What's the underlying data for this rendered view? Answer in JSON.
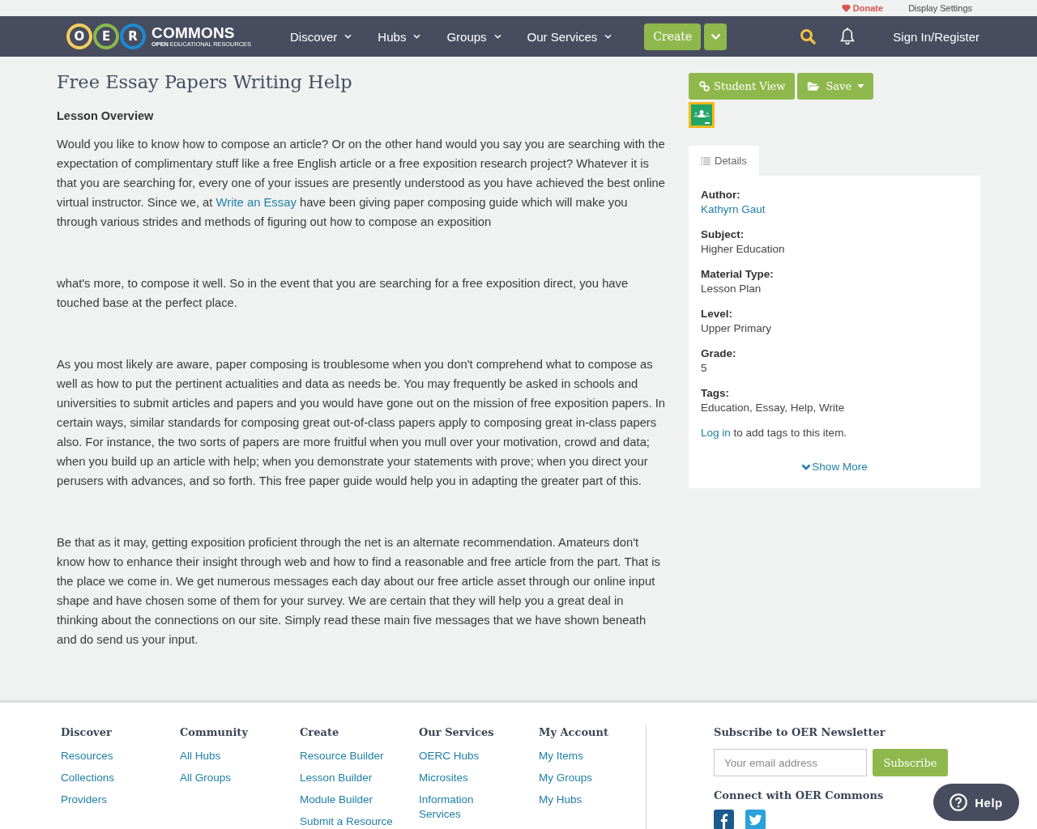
{
  "top_bar": {
    "donate": "Donate",
    "display_settings": "Display Settings"
  },
  "nav": {
    "logo": {
      "letters": [
        {
          "letter": "O",
          "color": "#f6cd5e"
        },
        {
          "letter": "E",
          "color": "#8bb94a"
        },
        {
          "letter": "R",
          "color": "#1e8ad2"
        }
      ],
      "wordmark": "COMMONS",
      "tagline": "**OPEN** EDUCATIONAL RESOURCES"
    },
    "menu": [
      {
        "label": "Discover"
      },
      {
        "label": "Hubs"
      },
      {
        "label": "Groups"
      },
      {
        "label": "Our Services"
      }
    ],
    "create": "Create",
    "sign_in": "Sign In/Register"
  },
  "article": {
    "title": "Free Essay Papers Writing Help",
    "section_heading": "Lesson Overview",
    "paragraphs": [
      {
        "parts": [
          {
            "kind": "text",
            "text": "Would you like to know how to compose an article? Or on the other hand would you say you are searching with the expectation of complimentary stuff like a free English article or a free exposition research project? Whatever it is that you are searching for, every one of your issues are presently understood as you have achieved the best online virtual instructor. Since we, at "
          },
          {
            "kind": "link",
            "text": "Write an Essay"
          },
          {
            "kind": "text",
            "text": " have been giving paper composing guide which will make you through various strides and methods of figuring out how to compose an exposition"
          }
        ]
      },
      {
        "parts": [
          {
            "kind": "text",
            "text": "what's more, to compose it well. So in the event that you are searching for a free exposition direct, you have touched base at the perfect place."
          }
        ]
      },
      {
        "parts": [
          {
            "kind": "text",
            "text": "As you most likely are aware, paper composing is troublesome when you don't comprehend what to compose as well as how to put the pertinent actualities and data as needs be. You may frequently be asked in schools and universities to submit articles and papers and you would have gone out on the mission of free exposition papers. In certain ways, similar standards for composing great out-of-class papers apply to composing great in-class papers also. For instance, the two sorts of papers are more fruitful when you mull over your motivation, crowd and data; when you build up an article with help; when you demonstrate your statements with prove; when you direct your perusers with advances, and so forth. This free paper guide would help you in adapting the greater part of this."
          }
        ]
      },
      {
        "parts": [
          {
            "kind": "text",
            "text": "Be that as it may, getting exposition proficient through the net is an alternate recommendation. Amateurs don't know how to enhance their insight through web and how to find a reasonable and free article from the part. That is the place we come in. We get numerous messages each day about our free article asset through our online input shape and have chosen some of them for your survey. We are certain that they will help you a great deal in thinking about the connections on our site. Simply read these main five messages that we have shown beneath and do send us your input."
          }
        ]
      }
    ]
  },
  "sidebar": {
    "actions": {
      "student_view": "Student View",
      "save": "Save"
    },
    "tabs": [
      {
        "label": "Details",
        "selected": true
      }
    ],
    "fields": [
      {
        "label": "Author:",
        "value": "Kathyrn Gaut",
        "kind": "link"
      },
      {
        "label": "Subject:",
        "value": "Higher Education",
        "kind": "text"
      },
      {
        "label": "Material Type:",
        "value": "Lesson Plan",
        "kind": "text"
      },
      {
        "label": "Level:",
        "value": "Upper Primary",
        "kind": "text"
      },
      {
        "label": "Grade:",
        "value": "5",
        "kind": "text"
      },
      {
        "label": "Tags:",
        "value": "Education, Essay, Help, Write",
        "kind": "text"
      }
    ],
    "tags_note": {
      "link": "Log in",
      "text": " to add tags to this item."
    },
    "show_more": "Show More"
  },
  "footer": {
    "columns": [
      {
        "heading": "Discover",
        "links": [
          "Resources",
          "Collections",
          "Providers"
        ]
      },
      {
        "heading": "Community",
        "links": [
          "All Hubs",
          "All Groups"
        ]
      },
      {
        "heading": "Create",
        "links": [
          "Resource Builder",
          "Lesson Builder",
          "Module Builder",
          "Submit a Resource"
        ]
      },
      {
        "heading": "Our Services",
        "links": [
          "OERC Hubs",
          "Microsites",
          "Information Services"
        ]
      },
      {
        "heading": "My Account",
        "links": [
          "My Items",
          "My Groups",
          "My Hubs"
        ]
      }
    ],
    "newsletter": {
      "heading": "Subscribe to OER Newsletter",
      "placeholder": "Your email address",
      "button": "Subscribe"
    },
    "connect_heading": "Connect with OER Commons"
  },
  "help": "Help"
}
